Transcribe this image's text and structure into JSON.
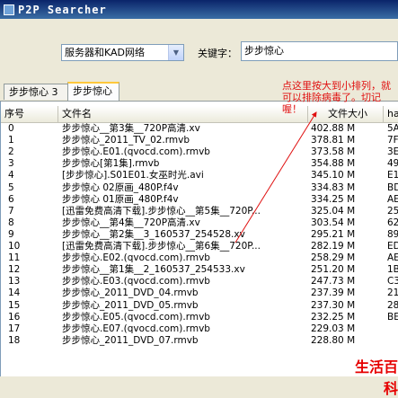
{
  "window": {
    "title": "P2P Searcher"
  },
  "toolbar": {
    "network_select": "服务器和KAD网络",
    "keyword_label": "关键字：",
    "keyword_value": "步步惊心"
  },
  "tabs": [
    {
      "label": "步步惊心 3"
    },
    {
      "label": "步步惊心"
    }
  ],
  "table": {
    "columns": [
      "序号",
      "文件名",
      "文件大小",
      "ha"
    ],
    "rows": [
      {
        "idx": "0",
        "name": "步步惊心__第3集__720P高清.xv",
        "size": "402.88 M",
        "hash": "5A"
      },
      {
        "idx": "1",
        "name": "步步惊心_2011_TV_02.rmvb",
        "size": "378.81 M",
        "hash": "7F"
      },
      {
        "idx": "2",
        "name": "步步惊心.E01.(qvocd.com).rmvb",
        "size": "373.58 M",
        "hash": "3E"
      },
      {
        "idx": "3",
        "name": "步步惊心[第1集].rmvb",
        "size": "354.88 M",
        "hash": "49"
      },
      {
        "idx": "4",
        "name": "[步步惊心].S01E01.女巫时光.avi",
        "size": "345.10 M",
        "hash": "E1"
      },
      {
        "idx": "5",
        "name": "步步惊心 02原画_480P.f4v",
        "size": "334.83 M",
        "hash": "BD"
      },
      {
        "idx": "6",
        "name": "步步惊心 01原画_480P.f4v",
        "size": "334.25 M",
        "hash": "AE"
      },
      {
        "idx": "7",
        "name": "[迅雷免费高清下载].步步惊心__第5集__720P...",
        "size": "325.04 M",
        "hash": "25"
      },
      {
        "idx": "8",
        "name": "步步惊心__第4集__720P高清.xv",
        "size": "303.54 M",
        "hash": "62"
      },
      {
        "idx": "9",
        "name": "步步惊心__第2集__3_160537_254528.xv",
        "size": "295.21 M",
        "hash": "89"
      },
      {
        "idx": "10",
        "name": "[迅雷免费高清下载].步步惊心__第6集__720P...",
        "size": "282.19 M",
        "hash": "ED"
      },
      {
        "idx": "11",
        "name": "步步惊心.E02.(qvocd.com).rmvb",
        "size": "258.29 M",
        "hash": "AE"
      },
      {
        "idx": "12",
        "name": "步步惊心__第1集__2_160537_254533.xv",
        "size": "251.20 M",
        "hash": "1B"
      },
      {
        "idx": "13",
        "name": "步步惊心.E03.(qvocd.com).rmvb",
        "size": "247.73 M",
        "hash": "C3"
      },
      {
        "idx": "14",
        "name": "步步惊心_2011_DVD_04.rmvb",
        "size": "237.39 M",
        "hash": "21"
      },
      {
        "idx": "15",
        "name": "步步惊心_2011_DVD_05.rmvb",
        "size": "237.30 M",
        "hash": "28"
      },
      {
        "idx": "16",
        "name": "步步惊心.E05.(qvocd.com).rmvb",
        "size": "232.25 M",
        "hash": "BE"
      },
      {
        "idx": "17",
        "name": "步步惊心.E07.(qvocd.com).rmvb",
        "size": "229.03 M",
        "hash": ""
      },
      {
        "idx": "18",
        "name": "步步惊心_2011_DVD_07.rmvb",
        "size": "228.80 M",
        "hash": ""
      }
    ]
  },
  "annotation": {
    "text": "点这里按大到小排列，就可以排除病毒了。切记喔！"
  },
  "watermark": {
    "chars": [
      "生",
      "活",
      "百",
      "科"
    ]
  },
  "colors": {
    "annotation": "#e01010",
    "watermark": "#e60000",
    "titlebar": "#0a246a"
  }
}
